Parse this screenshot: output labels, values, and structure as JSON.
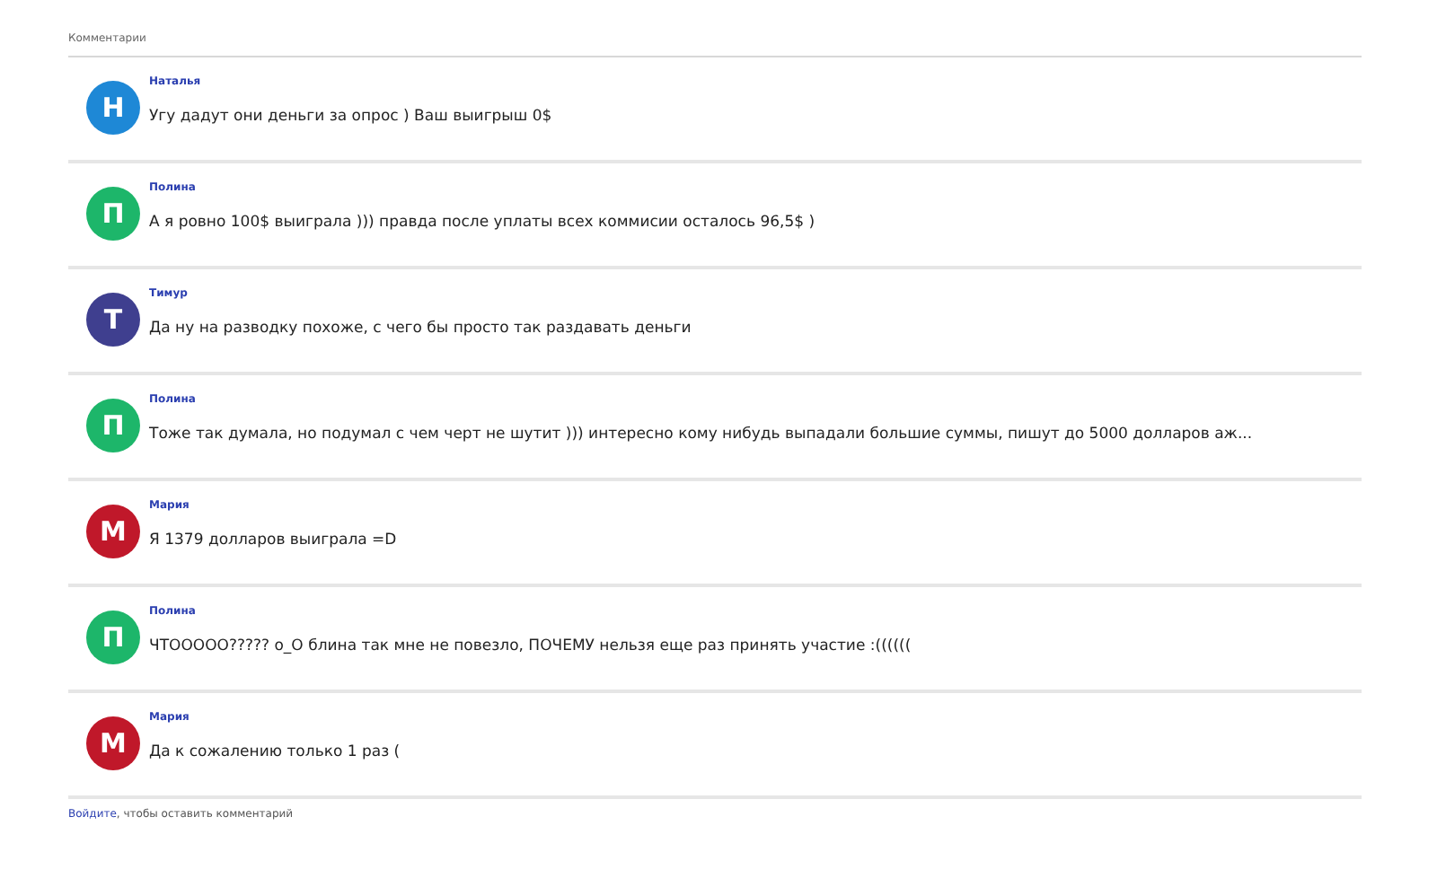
{
  "header": "Комментарии",
  "comments": [
    {
      "initial": "Н",
      "color": "#1e88d6",
      "author": "Наталья",
      "text": "Угу дадут они деньги за опрос ) Ваш выигрыш 0$"
    },
    {
      "initial": "П",
      "color": "#1db66a",
      "author": "Полина",
      "text": "А я ровно 100$ выиграла ))) правда после уплаты всех коммисии осталось 96,5$ )"
    },
    {
      "initial": "Т",
      "color": "#3f3f8f",
      "author": "Тимур",
      "text": "Да ну на разводку похоже, с чего бы просто так раздавать деньги"
    },
    {
      "initial": "П",
      "color": "#1db66a",
      "author": "Полина",
      "text": "Тоже так думала, но подумал с чем черт не шутит ))) интересно кому нибудь выпадали большие суммы, пишут до 5000 долларов аж..."
    },
    {
      "initial": "М",
      "color": "#c0182a",
      "author": "Мария",
      "text": "Я 1379 долларов выиграла =D"
    },
    {
      "initial": "П",
      "color": "#1db66a",
      "author": "Полина",
      "text": "ЧТООООО????? o_O блина так мне не повезло, ПОЧЕМУ нельзя еще раз принять участие :(((((("
    },
    {
      "initial": "М",
      "color": "#c0182a",
      "author": "Мария",
      "text": "Да к сожалению только 1 раз ("
    }
  ],
  "footer": {
    "link": "Войдите",
    "rest": ", чтобы оставить комментарий"
  }
}
